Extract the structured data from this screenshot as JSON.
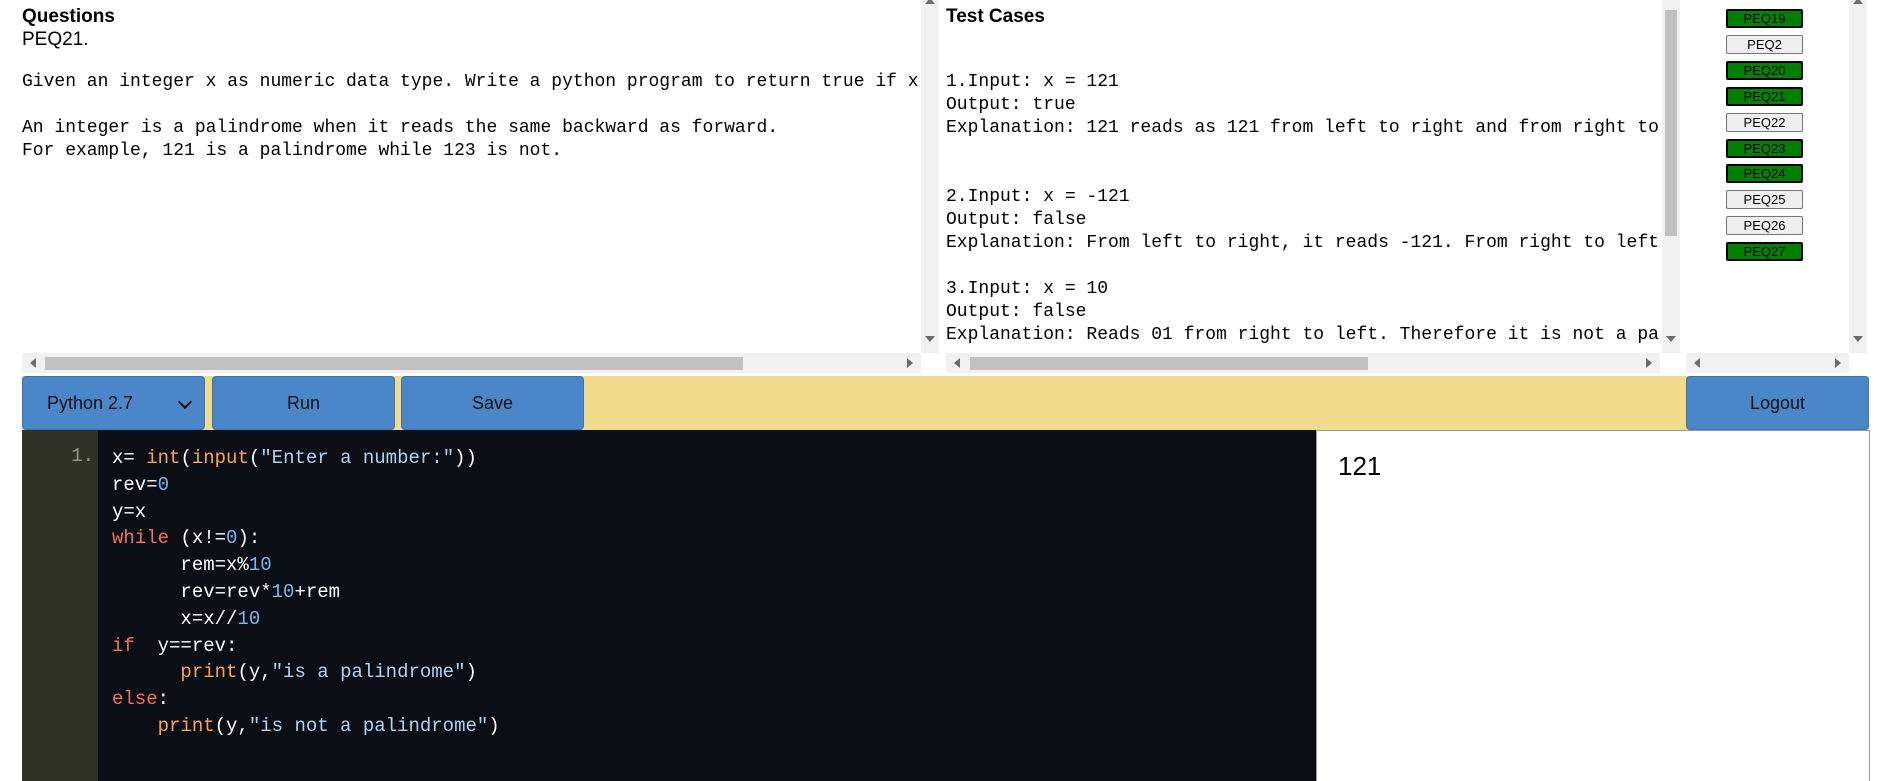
{
  "questions": {
    "heading": "Questions",
    "id": "PEQ21.",
    "lines": [
      "Given an integer x as numeric data type. Write a python program to return true if x i",
      "An integer is a palindrome when it reads the same backward as forward.",
      "For example, 121 is a palindrome while 123 is not."
    ]
  },
  "testcases": {
    "heading": "Test Cases",
    "lines": [
      "1.Input: x = 121",
      "Output: true",
      "Explanation: 121 reads as 121 from left to right and from right to",
      "2.Input: x = -121",
      "Output: false",
      "Explanation: From left to right, it reads -121. From right to left,",
      "3.Input: x = 10",
      "Output: false",
      "Explanation: Reads 01 from right to left. Therefore it is not a pal"
    ]
  },
  "problems": [
    {
      "label": "PEQ19",
      "status": "done"
    },
    {
      "label": "PEQ2",
      "status": "todo"
    },
    {
      "label": "PEQ20",
      "status": "done"
    },
    {
      "label": "PEQ21",
      "status": "done"
    },
    {
      "label": "PEQ22",
      "status": "todo"
    },
    {
      "label": "PEQ23",
      "status": "done"
    },
    {
      "label": "PEQ24",
      "status": "done"
    },
    {
      "label": "PEQ25",
      "status": "todo"
    },
    {
      "label": "PEQ26",
      "status": "todo"
    },
    {
      "label": "PEQ27",
      "status": "done"
    }
  ],
  "toolbar": {
    "language": "Python 2.7",
    "run_label": "Run",
    "save_label": "Save",
    "logout_label": "Logout"
  },
  "editor": {
    "line_number": "1.",
    "code": [
      "x= int(input(\"Enter a number:\"))",
      "rev=0",
      "y=x",
      "while (x!=0):",
      "      rem=x%10",
      "      rev=rev*10+rem",
      "      x=x//10",
      "if  y==rev:",
      "      print(y,\"is a palindrome\")",
      "else:",
      "    print(y,\"is not a palindrome\")"
    ]
  },
  "output": {
    "text": "121"
  },
  "colors": {
    "done": "#008000",
    "toolbar_bg": "#f0dc8c",
    "button_bg": "#4a86c8",
    "editor_bg": "#0b0e14",
    "gutter_bg": "#303127"
  }
}
